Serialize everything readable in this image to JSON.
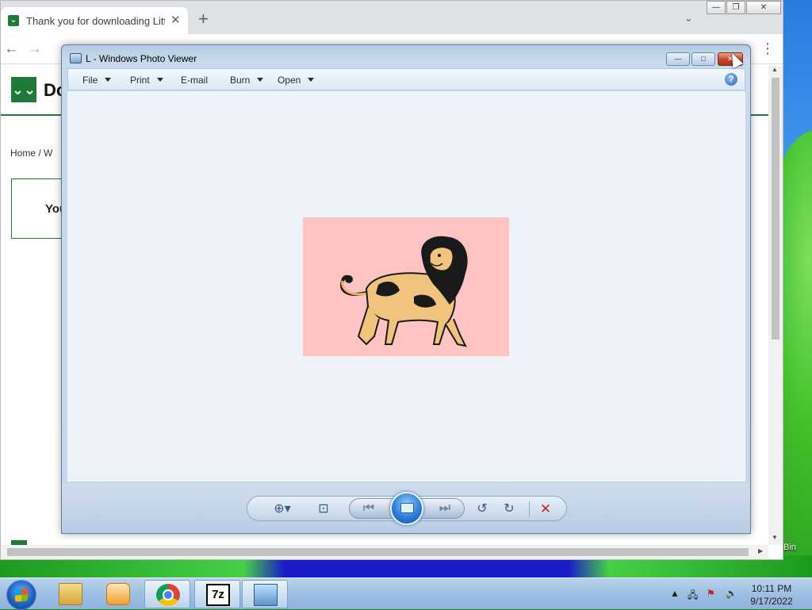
{
  "browser": {
    "tab_title": "Thank you for downloading Little",
    "tab_close": "✕",
    "new_tab": "+",
    "tab_search": "⌄",
    "window_min": "—",
    "window_max": "❐",
    "window_close": "✕",
    "back": "←",
    "forward": "→",
    "menu": "⋮",
    "site_logo_glyph": "⌄⌄",
    "site_name": "Do",
    "breadcrumb": "Home  /  W",
    "thanks_text": "You",
    "favicon_glyph": "⌄"
  },
  "viewer": {
    "title": "L - Windows Photo Viewer",
    "menu": {
      "file": "File",
      "print": "Print",
      "email": "E-mail",
      "burn": "Burn",
      "open": "Open"
    },
    "help": "?",
    "controls": {
      "zoom": "⊕▾",
      "actual_size": "⊡",
      "previous": "⏮",
      "next": "⏭",
      "rotate_ccw": "↺",
      "rotate_cw": "↻",
      "delete": "✕"
    },
    "window_buttons": {
      "minimize": "—",
      "maximize": "□",
      "close": "✕"
    },
    "photo_background": "#ffc3c3"
  },
  "taskbar": {
    "items": [
      {
        "name": "Windows Explorer",
        "icon": "folder-icon",
        "label": ""
      },
      {
        "name": "Windows Media Player",
        "icon": "media-player-icon",
        "label": ""
      },
      {
        "name": "Google Chrome",
        "icon": "chrome-icon",
        "label": ""
      },
      {
        "name": "7-Zip",
        "icon": "7zip-icon",
        "label": "7z"
      },
      {
        "name": "Windows Photo Viewer",
        "icon": "photo-viewer-icon",
        "label": ""
      }
    ],
    "tray": {
      "show_hidden": "▲",
      "network": "🖧",
      "flag": "⚑",
      "volume": "🔈"
    },
    "time": "10:11 PM",
    "date": "9/17/2022"
  },
  "desktop": {
    "recycle_bin_label": "Bin"
  }
}
